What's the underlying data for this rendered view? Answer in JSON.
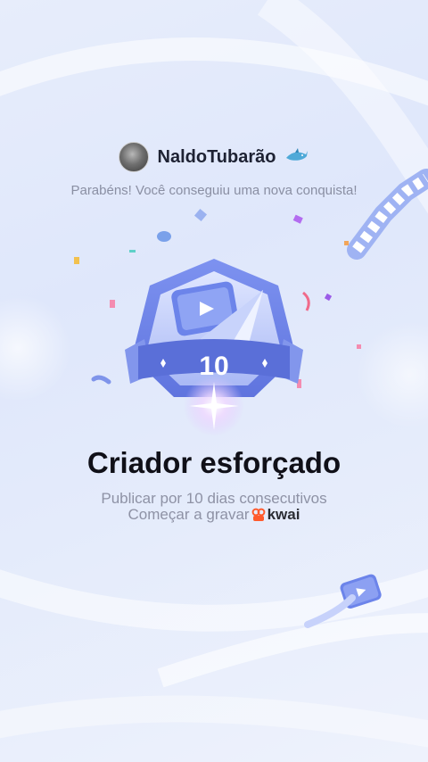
{
  "user": {
    "name": "NaldoTubarão",
    "avatar_icon": "user-avatar",
    "badge_icon": "shark-icon"
  },
  "congrats_text": "Parabéns! Você conseguiu uma nova conquista!",
  "badge": {
    "level": "10",
    "icon": "achievement-badge",
    "colors": {
      "primary": "#6a80e8",
      "light": "#c7d2fb",
      "ribbon": "#5a6fd8"
    }
  },
  "achievement": {
    "title": "Criador esforçado",
    "description": "Publicar por 10 dias consecutivos",
    "cta_label": "Começar a gravar",
    "brand": "kwai",
    "brand_color": "#ff5a2c"
  }
}
